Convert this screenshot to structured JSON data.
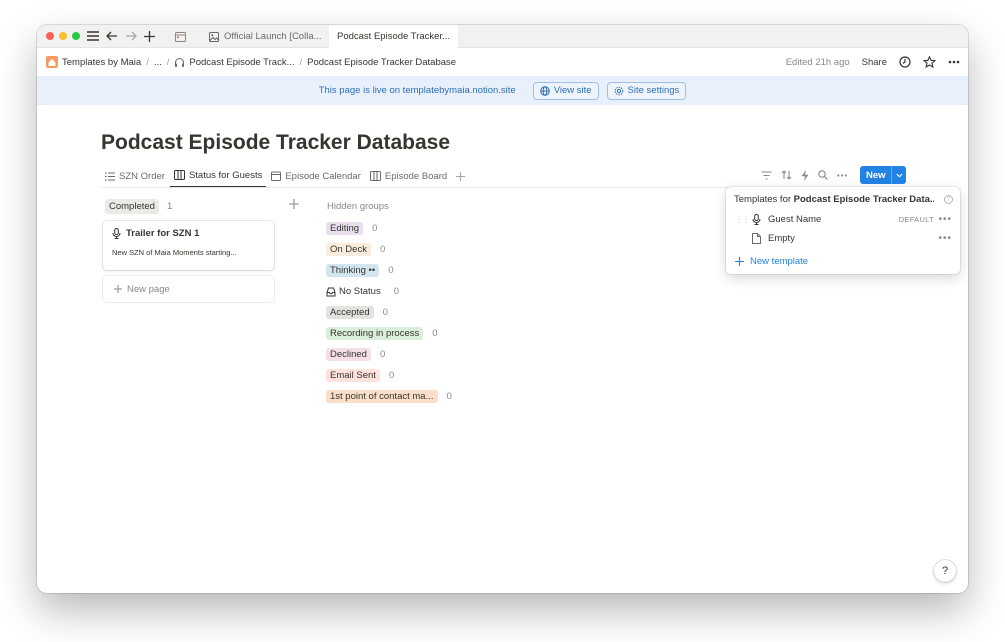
{
  "colors": {
    "close": "#ff5f57",
    "minimize": "#febc2e",
    "zoom": "#28c840",
    "accent": "#2383e2",
    "banner_bg": "#e8f0fb"
  },
  "browser": {
    "tabs": [
      {
        "label": "Official Launch [Colla...",
        "icon": "image-icon"
      },
      {
        "label": "Podcast Episode Tracker..."
      }
    ]
  },
  "breadcrumb": {
    "items": [
      "Templates by Maia",
      "...",
      "Podcast Episode Track...",
      "Podcast Episode Tracker Database"
    ]
  },
  "topbar": {
    "edited": "Edited 21h ago",
    "share": "Share"
  },
  "banner": {
    "text": "This page is live on templatebymaia.notion.site",
    "view_site": "View site",
    "site_settings": "Site settings"
  },
  "page": {
    "title": "Podcast Episode Tracker Database"
  },
  "views": [
    {
      "label": "SZN Order",
      "icon": "list-icon"
    },
    {
      "label": "Status for Guests",
      "icon": "board-icon",
      "active": true
    },
    {
      "label": "Episode Calendar",
      "icon": "calendar-icon"
    },
    {
      "label": "Episode Board",
      "icon": "board-icon"
    }
  ],
  "new_button": {
    "label": "New"
  },
  "board": {
    "group": {
      "label": "Completed",
      "count": "1"
    },
    "card": {
      "title": "Trailer for SZN 1",
      "description": "New SZN of Maia Moments starting..."
    },
    "new_page": "New page",
    "hidden_title": "Hidden groups",
    "hidden_groups": [
      {
        "label": "Editing",
        "count": "0",
        "color": "#e8deee"
      },
      {
        "label": "On Deck",
        "count": "0",
        "color": "#fbecdd"
      },
      {
        "label": "Thinking ••",
        "count": "0",
        "color": "#d3e5ef"
      },
      {
        "label": "No Status",
        "count": "0",
        "color": "transparent"
      },
      {
        "label": "Accepted",
        "count": "0",
        "color": "#e3e2e0"
      },
      {
        "label": "Recording in process",
        "count": "0",
        "color": "#dbeddb"
      },
      {
        "label": "Declined",
        "count": "0",
        "color": "#f5e0e9"
      },
      {
        "label": "Email Sent",
        "count": "0",
        "color": "#ffe2dd"
      },
      {
        "label": "1st point of contact ma...",
        "count": "0",
        "color": "#fadec9"
      }
    ]
  },
  "templates": {
    "prefix": "Templates for ",
    "db_name": "Podcast Episode Tracker Data...",
    "items": [
      {
        "name": "Guest Name",
        "badge": "DEFAULT"
      },
      {
        "name": "Empty",
        "badge": ""
      }
    ],
    "new_template": "New template"
  }
}
